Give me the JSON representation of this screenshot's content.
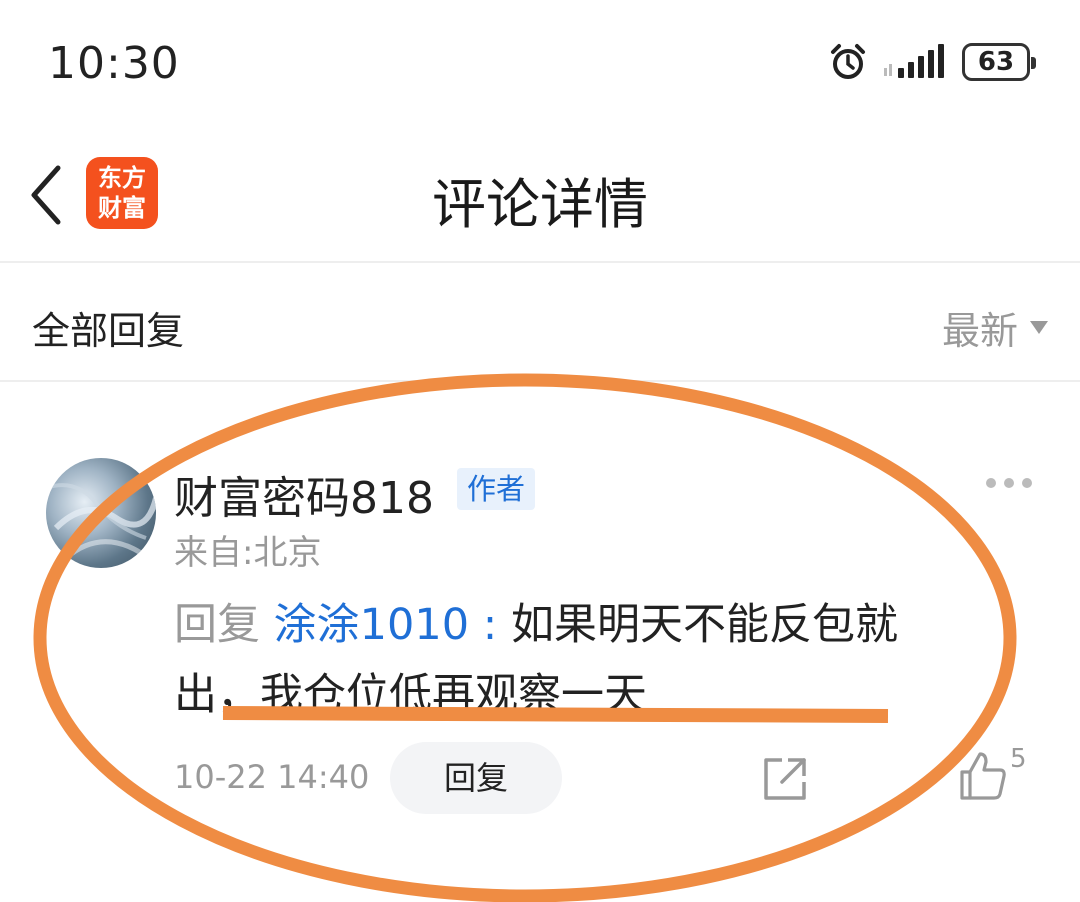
{
  "status_bar": {
    "time": "10:30",
    "battery": "63",
    "icons": [
      "alarm-icon",
      "signal-icon",
      "battery-icon"
    ]
  },
  "header": {
    "back_icon": "chevron-left-icon",
    "logo_line1": "东方",
    "logo_line2": "财富",
    "title": "评论详情"
  },
  "section": {
    "title": "全部回复",
    "sort_label": "最新"
  },
  "comment": {
    "username": "财富密码818",
    "badge": "作者",
    "location": "来自:北京",
    "reply_prefix": "回复",
    "mention": "涂涂1010",
    "separator": ":",
    "text": "如果明天不能反包就出，我仓位低再观察一天",
    "timestamp": "10-22 14:40",
    "reply_button": "回复",
    "like_count": "5"
  },
  "colors": {
    "brand": "#f4511e",
    "link": "#1f6fd6",
    "annotation": "#ef8c43"
  }
}
